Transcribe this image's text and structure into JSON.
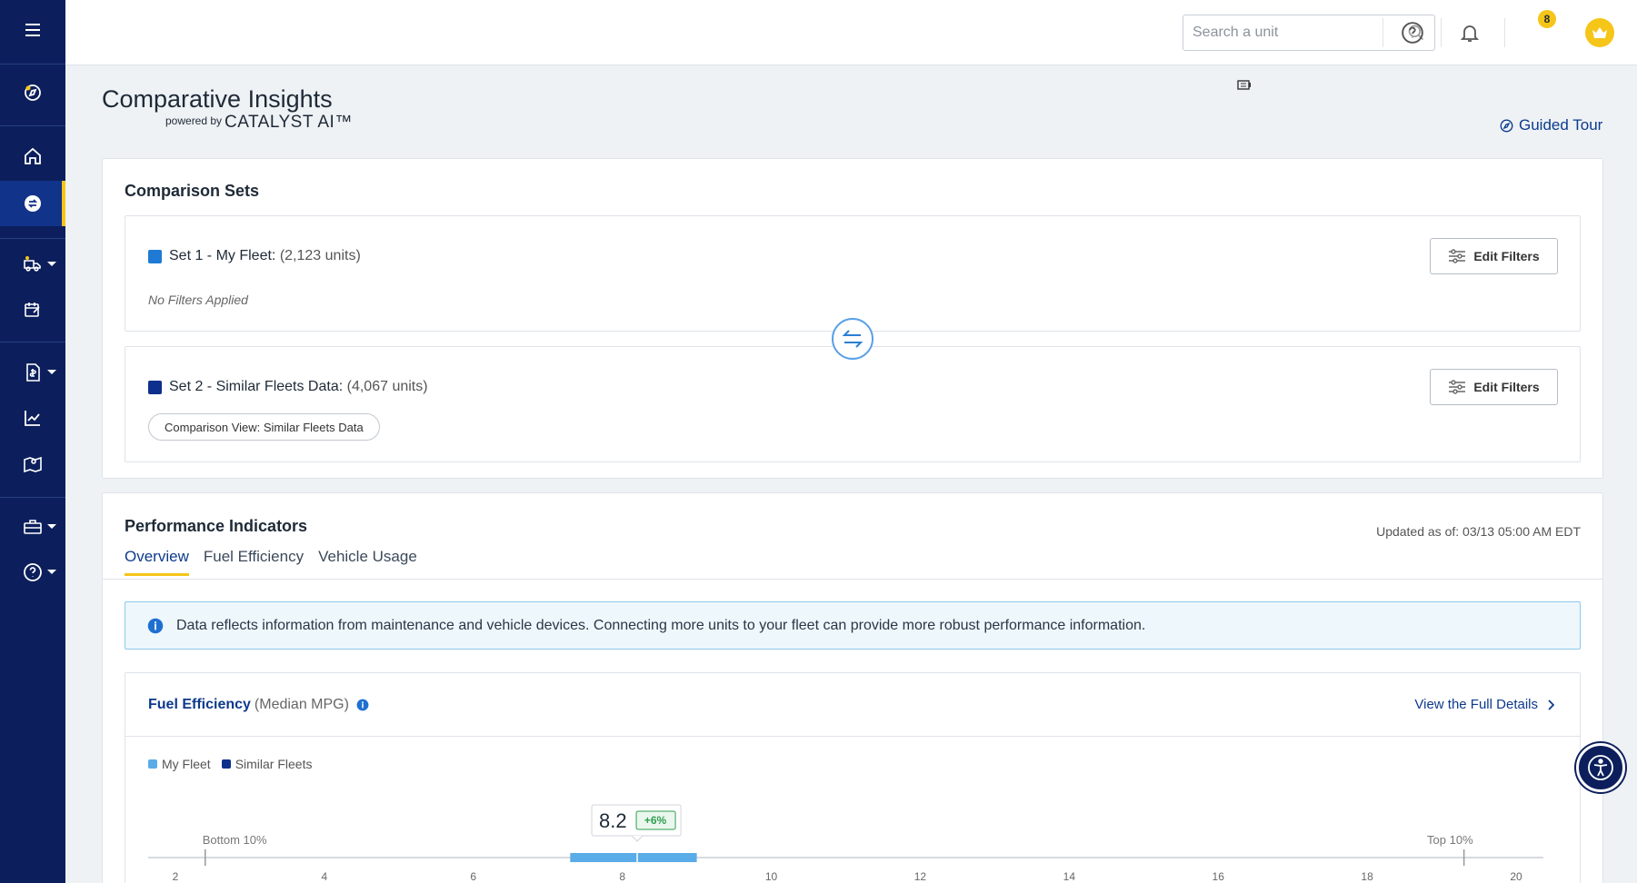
{
  "topbar": {
    "search_placeholder": "Search a unit",
    "notification_count": "8",
    "icons": [
      "search-icon",
      "help-icon",
      "bell-icon",
      "crown-icon",
      "chevron-down-icon"
    ]
  },
  "sidebar": {
    "items": [
      {
        "name": "menu-icon"
      },
      {
        "name": "compass-icon"
      },
      {
        "name": "home-icon"
      },
      {
        "name": "comparative-insights-icon",
        "active": true
      },
      {
        "name": "truck-icon",
        "dropdown": true
      },
      {
        "name": "calendar-wrench-icon"
      },
      {
        "name": "invoice-icon",
        "dropdown": true
      },
      {
        "name": "chart-line-icon"
      },
      {
        "name": "map-icon"
      },
      {
        "name": "toolbox-icon",
        "dropdown": true
      },
      {
        "name": "help-icon",
        "dropdown": true
      }
    ]
  },
  "header": {
    "title": "Comparative Insights",
    "powered_by": "powered by",
    "brand": "CATALYST AI™",
    "guided_tour": "Guided Tour"
  },
  "comparison_sets": {
    "title": "Comparison Sets",
    "set1": {
      "label": "Set 1 - My Fleet:",
      "units": "(2,123 units)",
      "color": "#1f7ad6",
      "filters_note": "No Filters Applied",
      "edit_label": "Edit Filters"
    },
    "set2": {
      "label": "Set 2 - Similar Fleets Data:",
      "units": "(4,067 units)",
      "color": "#0f2f8c",
      "chip": "Comparison View: Similar Fleets Data",
      "edit_label": "Edit Filters"
    }
  },
  "performance": {
    "title": "Performance Indicators",
    "updated": "Updated as of: 03/13 05:00 AM EDT",
    "tabs": [
      "Overview",
      "Fuel Efficiency",
      "Vehicle Usage"
    ],
    "active_tab": 0,
    "info_text": "Data reflects information from maintenance and vehicle devices. Connecting more units to your fleet can provide more robust performance information."
  },
  "fuel_card": {
    "title": "Fuel Efficiency",
    "subtitle": "(Median MPG)",
    "link": "View the Full Details",
    "legend": [
      {
        "label": "My Fleet",
        "color": "#5aace8"
      },
      {
        "label": "Similar Fleets",
        "color": "#0f2f8c"
      }
    ]
  },
  "chart_data": {
    "type": "bar",
    "title": "",
    "xlabel": "",
    "ylabel": "",
    "xlim": [
      2,
      20
    ],
    "ticks": [
      2,
      4,
      6,
      8,
      10,
      12,
      14,
      16,
      18,
      20
    ],
    "range_labels": {
      "low": "Bottom 10%",
      "high": "Top 10%"
    },
    "low_marker": 2.4,
    "high_marker": 19.3,
    "series": [
      {
        "name": "My Fleet",
        "range": [
          7.3,
          9.0
        ],
        "median": 8.2,
        "color": "#5aace8"
      }
    ],
    "callout": {
      "value": "8.2",
      "delta": "+6%"
    }
  }
}
